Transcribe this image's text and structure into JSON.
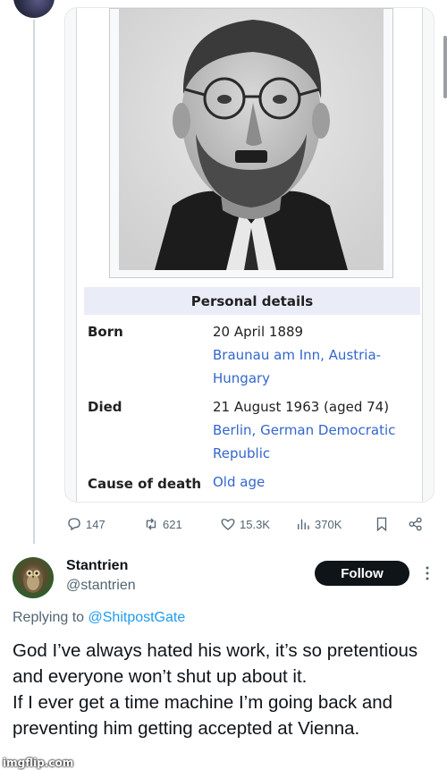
{
  "infobox": {
    "section_title": "Personal details",
    "rows": [
      {
        "label": "Born",
        "lines": [
          {
            "text": "20 April 1889",
            "link": false
          },
          {
            "text": "Braunau am Inn, Austria-",
            "link": true
          },
          {
            "text": "Hungary",
            "link": true
          }
        ]
      },
      {
        "label": "Died",
        "lines": [
          {
            "text": "21 August 1963 (aged 74)",
            "link": false
          },
          {
            "text": "Berlin, German Democratic",
            "link": true
          },
          {
            "text": "Republic",
            "link": true
          }
        ]
      },
      {
        "label": "Cause of death",
        "lines": [
          {
            "text": "Old age",
            "link": true
          }
        ]
      }
    ]
  },
  "actions": {
    "replies": "147",
    "reposts": "621",
    "likes": "15.3K",
    "views": "370K"
  },
  "reply": {
    "display_name": "Stantrien",
    "handle": "@stantrien",
    "follow_label": "Follow",
    "replying_prefix": "Replying to",
    "replying_to": "@ShitpostGate",
    "body_lines": [
      "God I’ve always hated his work, it’s so pretentious and everyone won’t shut up about it.",
      "If I ever get a time machine I’m going back and preventing him getting accepted at Vienna."
    ]
  },
  "watermark": "imgflip.com",
  "colors": {
    "link": "#3366cc",
    "mention": "#1d9bf0",
    "follow_bg": "#0f1419",
    "infobox_head": "#eaecf8"
  }
}
